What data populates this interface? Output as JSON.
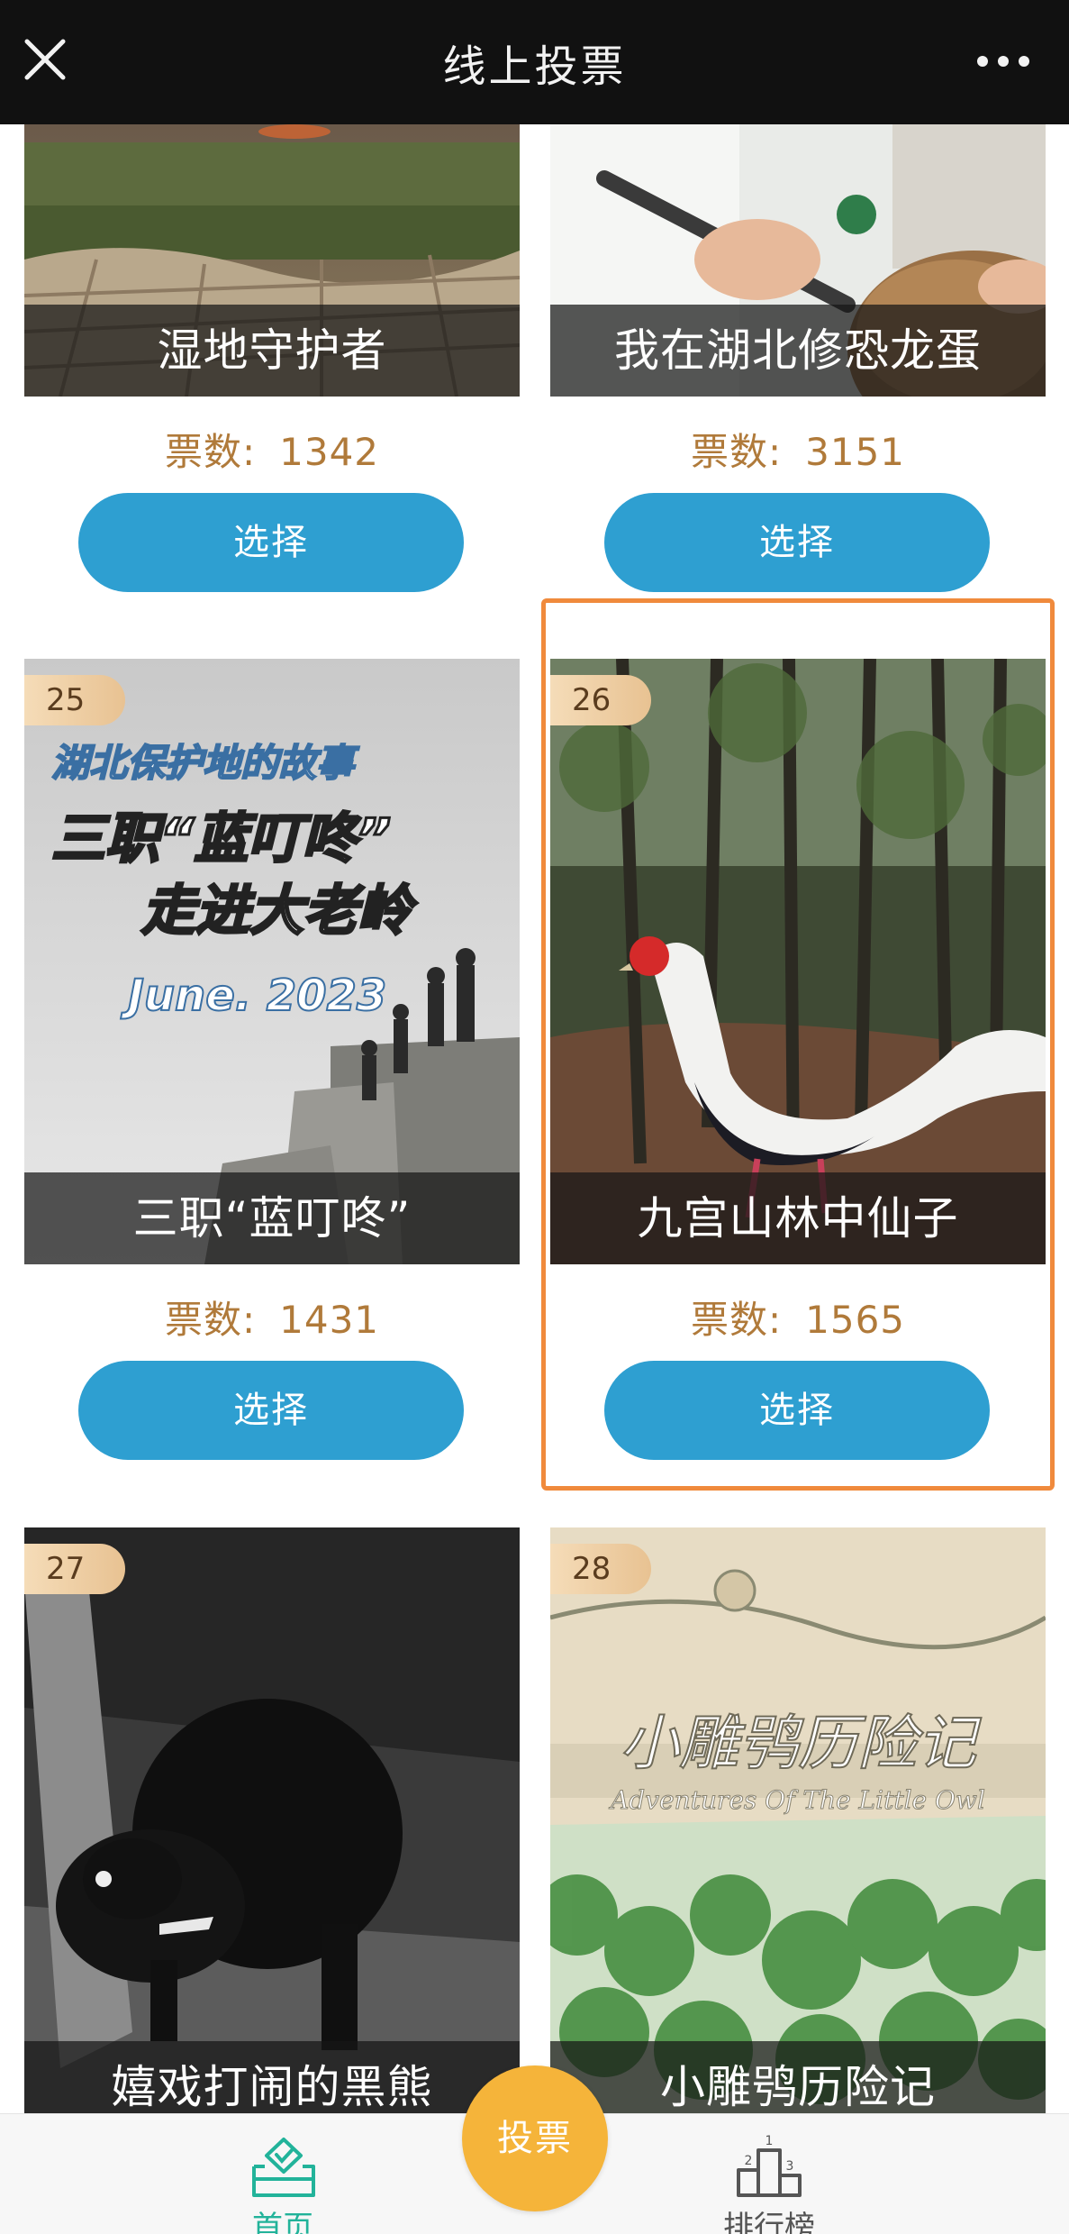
{
  "header": {
    "title": "线上投票",
    "close_icon": "close-icon",
    "more_icon": "more-dots-icon"
  },
  "vote_label": "票数:",
  "select_label": "选择",
  "items": [
    {
      "caption": "湿地守护者",
      "votes": "1342"
    },
    {
      "caption": "我在湖北修恐龙蛋",
      "votes": "3151"
    },
    {
      "number": "25",
      "caption": "三职“蓝叮咚”",
      "votes": "1431",
      "poster": {
        "title": "湖北保护地的故事",
        "line1": "三职“蓝叮咚”",
        "line2": "走进大老岭",
        "date": "June. 2023"
      }
    },
    {
      "number": "26",
      "caption": "九宫山林中仙子",
      "votes": "1565"
    },
    {
      "number": "27",
      "caption": "嬉戏打闹的黑熊"
    },
    {
      "number": "28",
      "caption": "小雕鸮历险记",
      "poster": {
        "title": "小雕鸮历险记",
        "subtitle": "Adventures Of The Little Owl"
      }
    }
  ],
  "tabbar": {
    "home_label": "首页",
    "vote_label": "投票",
    "rank_label": "排行榜",
    "home_icon": "ballot-box-icon",
    "rank_icon": "podium-icon",
    "podium_digits": {
      "first": "1",
      "second": "2",
      "third": "3"
    }
  },
  "colors": {
    "accent_blue": "#2e9fd1",
    "vote_text": "#b07a3a",
    "highlight_border": "#f08a3c",
    "vote_button": "#f5b43a",
    "home_active": "#22b39a"
  }
}
